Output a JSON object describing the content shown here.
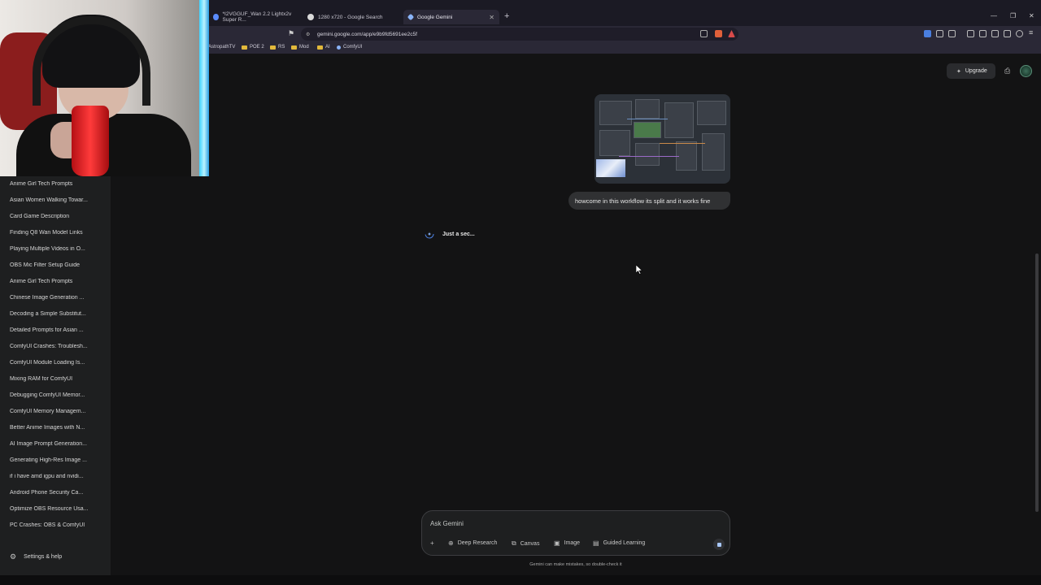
{
  "browser": {
    "tabs": [
      {
        "label": "*I2VGGUF_Wan 2.2 Lightx2v Super R...",
        "icon_color": "#5b8cff"
      },
      {
        "label": "1280 x720 - Google Search",
        "icon_color": "#d9d9d9"
      },
      {
        "label": "Google Gemini",
        "icon_color": "#8ab4f8"
      }
    ],
    "url": "gemini.google.com/app/e9b9fd5691ee2c5f",
    "bookmarks": [
      "AstropathTV",
      "POE 2",
      "RS",
      "Mod",
      "AI",
      "ComfyUI"
    ]
  },
  "sidebar": {
    "chats": [
      "Anime Girl Tech Prompts",
      "Asian Women Walking Towar...",
      "Card Game Description",
      "Finding Q8 Wan Model Links",
      "Playing Multiple Videos in O...",
      "OBS Mic Filter Setup Guide",
      "Anime Girl Tech Prompts",
      "Chinese Image Generation ...",
      "Decoding a Simple Substitut...",
      "Detailed Prompts for Asian ...",
      "ComfyUI Crashes: Troublesh...",
      "ComfyUI Module Loading Is...",
      "Mixing RAM for ComfyUI",
      "Debugging ComfyUI Memor...",
      "ComfyUI Memory Managem...",
      "Better Anime Images with N...",
      "AI Image Prompt Generation...",
      "Generating High-Res Image ...",
      "if i have amd igpu and nvidi...",
      "Android Phone Security Ca...",
      "Optimize OBS Resource Usa...",
      "PC Crashes: OBS & ComfyUI"
    ],
    "settings_label": "Settings & help"
  },
  "header": {
    "upgrade_label": "Upgrade"
  },
  "conversation": {
    "user_message": "howcome in this workflow its split and it works fine",
    "reply_status": "Just a sec..."
  },
  "composer": {
    "placeholder": "Ask Gemini",
    "tools": [
      "Deep Research",
      "Canvas",
      "Image",
      "Guided Learning"
    ],
    "disclaimer": "Gemini can make mistakes, so double-check it"
  },
  "colors": {
    "background": "#131314",
    "sidebar": "#1e1f20",
    "accent": "#a8c7fa"
  }
}
